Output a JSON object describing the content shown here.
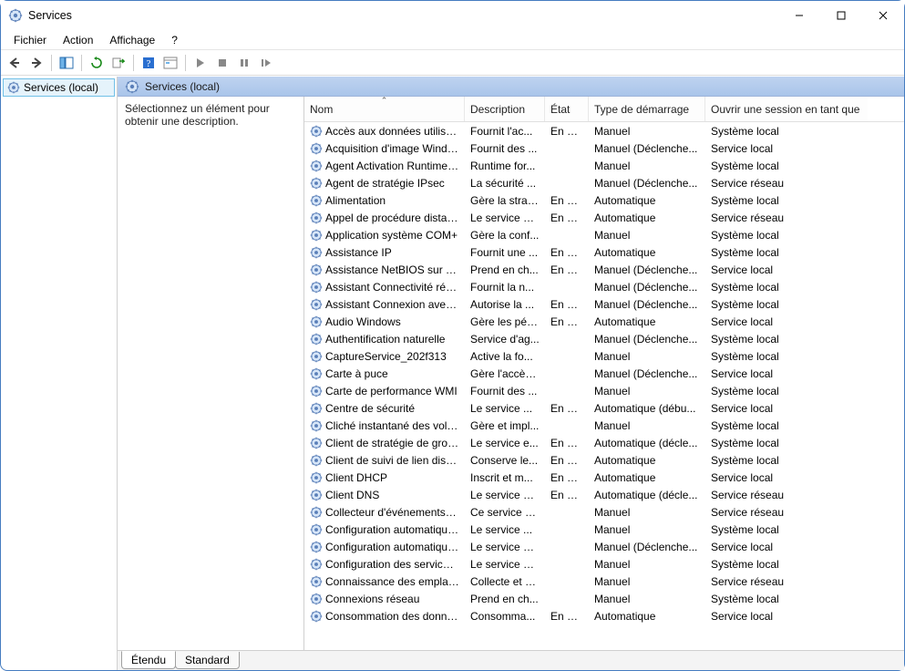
{
  "window": {
    "title": "Services"
  },
  "menu": {
    "file": "Fichier",
    "action": "Action",
    "view": "Affichage",
    "help": "?"
  },
  "tree": {
    "root": "Services (local)"
  },
  "pane": {
    "title": "Services (local)",
    "hint": "Sélectionnez un élément pour obtenir une description."
  },
  "columns": {
    "name": "Nom",
    "description": "Description",
    "state": "État",
    "startup": "Type de démarrage",
    "logon": "Ouvrir une session en tant que"
  },
  "tabs": {
    "extended": "Étendu",
    "standard": "Standard"
  },
  "services": [
    {
      "name": "Accès aux données utilisate...",
      "desc": "Fournit l'ac...",
      "state": "En co...",
      "startup": "Manuel",
      "logon": "Système local"
    },
    {
      "name": "Acquisition d'image Windo...",
      "desc": "Fournit des ...",
      "state": "",
      "startup": "Manuel (Déclenche...",
      "logon": "Service local"
    },
    {
      "name": "Agent Activation Runtime_...",
      "desc": "Runtime for...",
      "state": "",
      "startup": "Manuel",
      "logon": "Système local"
    },
    {
      "name": "Agent de stratégie IPsec",
      "desc": "La sécurité ...",
      "state": "",
      "startup": "Manuel (Déclenche...",
      "logon": "Service réseau"
    },
    {
      "name": "Alimentation",
      "desc": "Gère la strat...",
      "state": "En co...",
      "startup": "Automatique",
      "logon": "Système local"
    },
    {
      "name": "Appel de procédure distant...",
      "desc": "Le service R...",
      "state": "En co...",
      "startup": "Automatique",
      "logon": "Service réseau"
    },
    {
      "name": "Application système COM+",
      "desc": "Gère la conf...",
      "state": "",
      "startup": "Manuel",
      "logon": "Système local"
    },
    {
      "name": "Assistance IP",
      "desc": "Fournit une ...",
      "state": "En co...",
      "startup": "Automatique",
      "logon": "Système local"
    },
    {
      "name": "Assistance NetBIOS sur TCP...",
      "desc": "Prend en ch...",
      "state": "En co...",
      "startup": "Manuel (Déclenche...",
      "logon": "Service local"
    },
    {
      "name": "Assistant Connectivité réseau",
      "desc": "Fournit la n...",
      "state": "",
      "startup": "Manuel (Déclenche...",
      "logon": "Système local"
    },
    {
      "name": "Assistant Connexion avec u...",
      "desc": "Autorise la ...",
      "state": "En co...",
      "startup": "Manuel (Déclenche...",
      "logon": "Système local"
    },
    {
      "name": "Audio Windows",
      "desc": "Gère les péri...",
      "state": "En co...",
      "startup": "Automatique",
      "logon": "Service local"
    },
    {
      "name": "Authentification naturelle",
      "desc": "Service d'ag...",
      "state": "",
      "startup": "Manuel (Déclenche...",
      "logon": "Système local"
    },
    {
      "name": "CaptureService_202f313",
      "desc": "Active la fo...",
      "state": "",
      "startup": "Manuel",
      "logon": "Système local"
    },
    {
      "name": "Carte à puce",
      "desc": "Gère l'accès...",
      "state": "",
      "startup": "Manuel (Déclenche...",
      "logon": "Service local"
    },
    {
      "name": "Carte de performance WMI",
      "desc": "Fournit des ...",
      "state": "",
      "startup": "Manuel",
      "logon": "Système local"
    },
    {
      "name": "Centre de sécurité",
      "desc": "Le service ...",
      "state": "En co...",
      "startup": "Automatique (débu...",
      "logon": "Service local"
    },
    {
      "name": "Cliché instantané des volu...",
      "desc": "Gère et impl...",
      "state": "",
      "startup": "Manuel",
      "logon": "Système local"
    },
    {
      "name": "Client de stratégie de groupe",
      "desc": "Le service e...",
      "state": "En co...",
      "startup": "Automatique (décle...",
      "logon": "Système local"
    },
    {
      "name": "Client de suivi de lien distri...",
      "desc": "Conserve le...",
      "state": "En co...",
      "startup": "Automatique",
      "logon": "Système local"
    },
    {
      "name": "Client DHCP",
      "desc": "Inscrit et m...",
      "state": "En co...",
      "startup": "Automatique",
      "logon": "Service local"
    },
    {
      "name": "Client DNS",
      "desc": "Le service cl...",
      "state": "En co...",
      "startup": "Automatique (décle...",
      "logon": "Service réseau"
    },
    {
      "name": "Collecteur d'événements de...",
      "desc": "Ce service g...",
      "state": "",
      "startup": "Manuel",
      "logon": "Service réseau"
    },
    {
      "name": "Configuration automatique...",
      "desc": "Le service ...",
      "state": "",
      "startup": "Manuel",
      "logon": "Système local"
    },
    {
      "name": "Configuration automatique...",
      "desc": "Le service C...",
      "state": "",
      "startup": "Manuel (Déclenche...",
      "logon": "Service local"
    },
    {
      "name": "Configuration des services ...",
      "desc": "Le service C...",
      "state": "",
      "startup": "Manuel",
      "logon": "Système local"
    },
    {
      "name": "Connaissance des emplace...",
      "desc": "Collecte et s...",
      "state": "",
      "startup": "Manuel",
      "logon": "Service réseau"
    },
    {
      "name": "Connexions réseau",
      "desc": "Prend en ch...",
      "state": "",
      "startup": "Manuel",
      "logon": "Système local"
    },
    {
      "name": "Consommation des données",
      "desc": "Consomma...",
      "state": "En co...",
      "startup": "Automatique",
      "logon": "Service local"
    }
  ]
}
